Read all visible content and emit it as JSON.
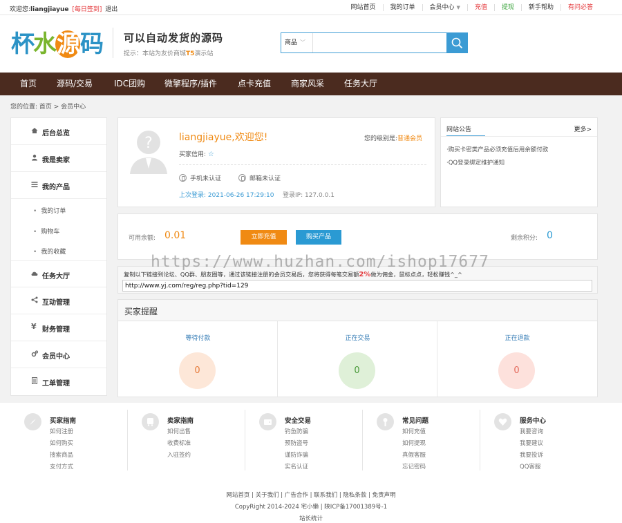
{
  "topbar": {
    "welcome": "欢迎您:",
    "username": "liangjiayue",
    "sign_in": "[每日签到]",
    "logout": "退出",
    "links": [
      "网站首页",
      "我的订单",
      "会员中心",
      "充值",
      "提现",
      "新手帮助",
      "有问必答"
    ]
  },
  "header": {
    "logo_text": [
      "杯",
      "水",
      "源",
      "码"
    ],
    "slogan": "可以自动发货的源码",
    "tip_prefix": "提示：本站为友价商城",
    "tip_ts": "T5",
    "tip_suffix": "演示站",
    "search": {
      "category": "商品",
      "value": ""
    }
  },
  "nav": [
    "首页",
    "源码/交易",
    "IDC团购",
    "微擎程序/插件",
    "点卡充值",
    "商家风采",
    "任务大厅"
  ],
  "breadcrumb": "您的位置: 首页 > 会员中心",
  "sidebar": {
    "items": [
      "后台总览",
      "我是卖家",
      "我的产品",
      "任务大厅",
      "互动管理",
      "财务管理",
      "会员中心",
      "工单管理"
    ],
    "subitems": [
      "我的订单",
      "购物车",
      "我的收藏"
    ]
  },
  "user": {
    "greeting": "liangjiayue,欢迎您!",
    "level_label": "您的级别是:",
    "level": "普通会员",
    "credit_label": "买家信用:",
    "phone_auth": "手机未认证",
    "email_auth": "邮箱未认证",
    "last_login": "上次登录: 2021-06-26 17:29:10",
    "login_ip": "登录IP: 127.0.0.1"
  },
  "notice": {
    "title": "网站公告",
    "more": "更多>",
    "items": [
      "·购买卡密类产品必须充值后用余额付款",
      "·QQ登录绑定维护通知"
    ]
  },
  "balance": {
    "label": "可用余额:",
    "value": "0.01",
    "recharge": "立即充值",
    "buy": "购买产品",
    "points_label": "剩余积分:",
    "points": "0"
  },
  "referral": {
    "text_pre": "复制以下链接到论坛、QQ群、朋友圈等，通过该链接注册的会员交易后，您将获得每笔交易额",
    "pct": "2%",
    "text_post": "做为佣金，鼠标点点，轻松赚钱^_^",
    "url": "http://www.yj.com/reg/reg.php?tid=129"
  },
  "watermark": "https://www.huzhan.com/ishop17677",
  "remind": {
    "title": "买家提醒",
    "cols": [
      {
        "label": "等待付款",
        "count": "0"
      },
      {
        "label": "正在交易",
        "count": "0"
      },
      {
        "label": "正在退款",
        "count": "0"
      }
    ]
  },
  "footer": {
    "cols": [
      {
        "title": "买家指南",
        "links": [
          "如何注册",
          "如何购买",
          "搜索商品",
          "支付方式"
        ]
      },
      {
        "title": "卖家指南",
        "links": [
          "如何出售",
          "收费标准",
          "入驻签约"
        ]
      },
      {
        "title": "安全交易",
        "links": [
          "钓鱼防骗",
          "预防盗号",
          "谨防诈骗",
          "实名认证"
        ]
      },
      {
        "title": "常见问题",
        "links": [
          "如何充值",
          "如何提现",
          "真假客服",
          "忘记密码"
        ]
      },
      {
        "title": "服务中心",
        "links": [
          "我要咨询",
          "我要建议",
          "我要投诉",
          "QQ客服"
        ]
      }
    ],
    "links": "网站首页 | 关于我们 | 广告合作 | 联系我们 | 隐私条款 | 免责声明",
    "copyright": "CopyRight 2014-2024 宅小懒 | 陕ICP备17001389号-1",
    "stats": "站长统计"
  }
}
